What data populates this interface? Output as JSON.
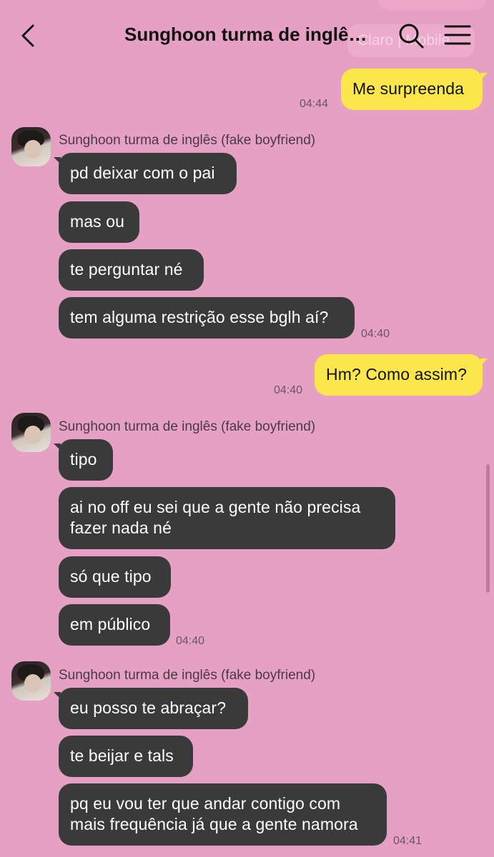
{
  "header": {
    "title": "Sunghoon turma de inglê…",
    "overlay_text": "Claro | Mobile"
  },
  "sender_name": "Sunghoon turma de inglês (fake boyfriend)",
  "messages": {
    "m1": "Me surpreenda",
    "m2": "pd deixar com o pai",
    "m3": "mas ou",
    "m4": "te perguntar né",
    "m5": "tem alguma restrição esse bglh aí?",
    "m6": "Hm? Como assim?",
    "m7": "tipo",
    "m8_line1": "ai no off eu sei que a gente não precisa",
    "m8_line2": "fazer nada né",
    "m9": "só que tipo",
    "m10": "em público",
    "m11": "eu posso te abraçar?",
    "m12": "te beijar e tals",
    "m13_line1": "pq eu vou ter que andar contigo com",
    "m13_line2": "mais frequência já que a gente namora"
  },
  "times": {
    "t1": "04:44",
    "t2": "04:40",
    "t3": "04:40",
    "t4": "04:40",
    "t5": "04:41"
  },
  "colors": {
    "background": "#e6a0c4",
    "my_bubble": "#fbe74c",
    "their_bubble": "#3a3a3a"
  },
  "icons": [
    "back-icon",
    "search-icon",
    "menu-icon"
  ]
}
